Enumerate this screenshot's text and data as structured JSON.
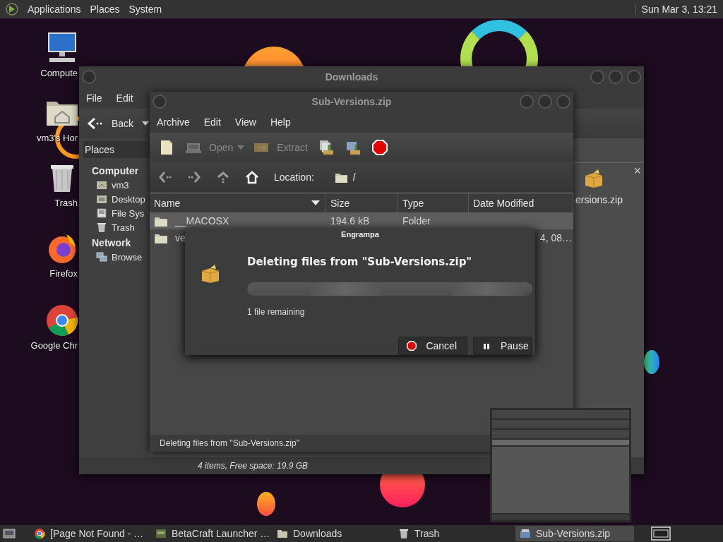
{
  "top_panel": {
    "menus": [
      "Applications",
      "Places",
      "System"
    ],
    "clock": "Sun Mar 3, 13:21"
  },
  "desktop_icons": [
    {
      "label": "Compute",
      "kind": "computer"
    },
    {
      "label": "vm3's Hor",
      "kind": "home"
    },
    {
      "label": "Trash",
      "kind": "trash"
    },
    {
      "label": "Firefox",
      "kind": "firefox"
    },
    {
      "label": "Google Chr",
      "kind": "chrome"
    }
  ],
  "downloads_window": {
    "title": "Downloads",
    "menus": [
      "File",
      "Edit"
    ],
    "back_button": "Back",
    "sidebar": {
      "header": "Places",
      "sections": [
        {
          "title": "Computer",
          "items": [
            {
              "label": "vm3",
              "kind": "home"
            },
            {
              "label": "Desktop",
              "kind": "desktop"
            },
            {
              "label": "File Sys",
              "kind": "drive"
            },
            {
              "label": "Trash",
              "kind": "trash"
            }
          ]
        },
        {
          "title": "Network",
          "items": [
            {
              "label": "Browse",
              "kind": "network"
            }
          ]
        }
      ]
    },
    "close_label": "×",
    "files": [
      {
        "label": "ersions.zip",
        "kind": "archive"
      }
    ],
    "status": "4 items, Free space: 19.9 GB"
  },
  "archive_window": {
    "title": "Sub-Versions.zip",
    "menus": [
      "Archive",
      "Edit",
      "View",
      "Help"
    ],
    "toolbar": [
      {
        "kind": "new",
        "disabled": false
      },
      {
        "kind": "open",
        "label": "Open",
        "disabled": true
      },
      {
        "kind": "extract",
        "label": "Extract",
        "disabled": true
      },
      {
        "kind": "add-files",
        "disabled": false
      },
      {
        "kind": "add-folder",
        "disabled": false
      },
      {
        "kind": "stop",
        "disabled": false
      }
    ],
    "location_label": "Location:",
    "location": "/",
    "columns": [
      "Name",
      "Size",
      "Type",
      "Date Modified"
    ],
    "rows": [
      {
        "name": "__MACOSX",
        "size": "194.6 kB",
        "type": "Folder",
        "selected": true
      },
      {
        "name": "ve",
        "date": "4, 08…",
        "selected": false
      }
    ],
    "status": "Deleting files from \"Sub-Versions.zip\""
  },
  "dialog": {
    "title": "Engrampa",
    "heading": "Deleting files from \"Sub-Versions.zip\"",
    "progress": {
      "indeterminate": true
    },
    "note": "1 file remaining",
    "buttons": [
      {
        "kind": "cancel",
        "label": "Cancel"
      },
      {
        "kind": "pause",
        "label": "Pause"
      }
    ]
  },
  "taskbar": {
    "items": [
      {
        "label": "[Page Not Found - …",
        "kind": "browser",
        "selected": false
      },
      {
        "label": "BetaCraft Launcher …",
        "kind": "app",
        "selected": false
      },
      {
        "label": "Downloads",
        "kind": "folder",
        "selected": false
      },
      {
        "label": "Trash",
        "kind": "trash",
        "selected": false
      },
      {
        "label": "Sub-Versions.zip",
        "kind": "archive",
        "selected": true
      }
    ]
  }
}
